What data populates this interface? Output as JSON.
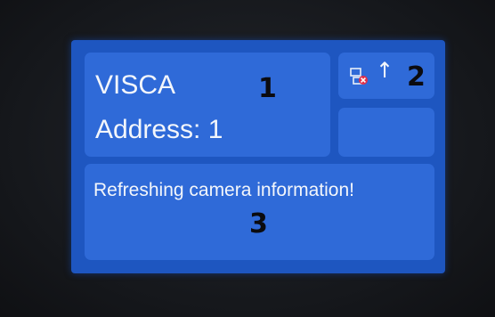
{
  "main": {
    "protocol": "VISCA",
    "address": "Address: 1",
    "marker": "1"
  },
  "status": {
    "marker": "2",
    "icons": [
      "network-disconnected-icon",
      "arrow-up-icon"
    ],
    "arrow_glyph": "↑"
  },
  "message": {
    "text": "Refreshing camera information!",
    "marker": "3"
  },
  "colors": {
    "screen_bg": "#1e56c0",
    "panel_bg": "#2f6ad8",
    "text": "#f3f6fb",
    "error_badge": "#e0304a"
  }
}
